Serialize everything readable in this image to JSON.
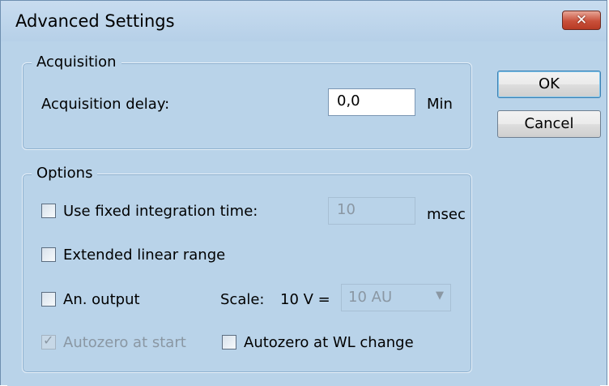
{
  "window": {
    "title": "Advanced Settings",
    "close_icon": "close-icon"
  },
  "acquisition": {
    "group_label": "Acquisition",
    "delay_label": "Acquisition delay:",
    "delay_value": "0,0",
    "delay_unit": "Min"
  },
  "options": {
    "group_label": "Options",
    "fixed_integration": {
      "label": "Use fixed integration time:",
      "checked": false,
      "value": "10",
      "unit": "msec",
      "enabled": false
    },
    "extended_linear": {
      "label": "Extended linear range",
      "checked": false
    },
    "an_output": {
      "label": "An. output",
      "checked": false,
      "scale_label": "Scale:",
      "scale_prefix": "10 V =",
      "scale_value": "10 AU",
      "scale_enabled": false
    },
    "autozero_start": {
      "label": "Autozero at start",
      "checked": true,
      "enabled": false
    },
    "autozero_wl": {
      "label": "Autozero at WL change",
      "checked": false
    }
  },
  "buttons": {
    "ok": "OK",
    "cancel": "Cancel"
  },
  "colors": {
    "dialog_bg": "#b9d3e9",
    "close_button": "#c9503a"
  }
}
